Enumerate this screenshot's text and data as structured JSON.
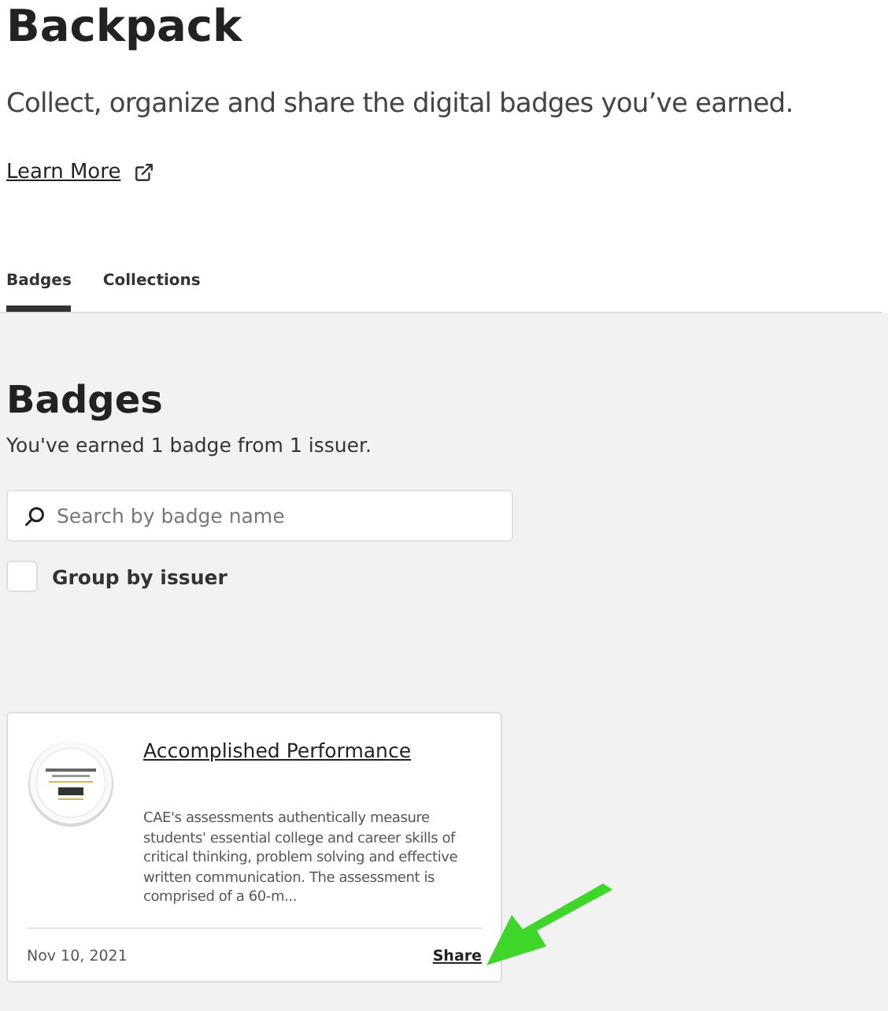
{
  "header": {
    "title": "Backpack",
    "subtitle": "Collect, organize and share the digital badges you’ve earned.",
    "learn_more": "Learn More"
  },
  "tabs": [
    {
      "label": "Badges",
      "selected": true
    },
    {
      "label": "Collections",
      "selected": false
    }
  ],
  "badges_section": {
    "heading": "Badges",
    "summary": "You've earned 1 badge from 1 issuer.",
    "search": {
      "placeholder": "Search by badge name"
    },
    "group_by_issuer": {
      "label": "Group by issuer",
      "checked": false
    }
  },
  "cards": [
    {
      "title": "Accomplished Performance",
      "description": "CAE's assessments authentically measure students' essential college and career skills of critical thinking, problem solving and effective written communication. The assessment is comprised of a 60-m...",
      "date": "Nov 10, 2021",
      "action": "Share"
    }
  ]
}
